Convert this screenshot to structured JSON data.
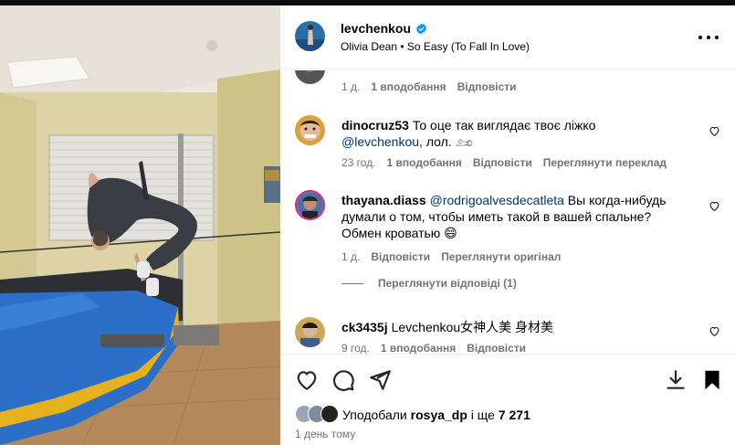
{
  "post": {
    "username": "levchenkou",
    "music": "Olivia Dean • So Easy (To Fall In Love)",
    "time": "1 день тому"
  },
  "comments": [
    {
      "id": "prev",
      "meta": {
        "time": "1 д.",
        "likes": "1 вподобання",
        "reply": "Відповісти"
      }
    },
    {
      "id": "c1",
      "username": "dinocruz53",
      "text_before": "То оце так виглядає твоє ліжко ",
      "mention": "@levchenkou",
      "text_after": ", лол. 𓃭",
      "meta": {
        "time": "23 год.",
        "likes": "1 вподобання",
        "reply": "Відповісти",
        "translate": "Переглянути переклад"
      }
    },
    {
      "id": "c2",
      "username": "thayana.diass",
      "mention": "@rodrigoalvesdecatleta",
      "text_after": " Вы когда-нибудь думали о том, чтобы иметь такой в вашей спальне? Обмен кроватью 😄",
      "meta": {
        "time": "1 д.",
        "reply": "Відповісти",
        "original": "Переглянути оригінал"
      },
      "view_replies": "Переглянути відповіді (1)"
    },
    {
      "id": "c3",
      "username": "ck3435j",
      "text_after": "Levchenkou女神人美 身材美",
      "meta": {
        "time": "9 год.",
        "likes": "1 вподобання",
        "reply": "Відповісти"
      }
    }
  ],
  "likes": {
    "prefix": "Уподобали ",
    "user": "rosya_dp",
    "middle": " і ще ",
    "count": "7 271"
  },
  "icons": {
    "like": "heart-icon",
    "comment": "comment-icon",
    "share": "share-icon",
    "save": "bookmark-icon",
    "download": "download-icon",
    "more": "more-icon",
    "verified": "verified-icon"
  },
  "colors": {
    "verified": "#0095f6",
    "mention": "#00376b",
    "secondary_text": "#737373"
  }
}
